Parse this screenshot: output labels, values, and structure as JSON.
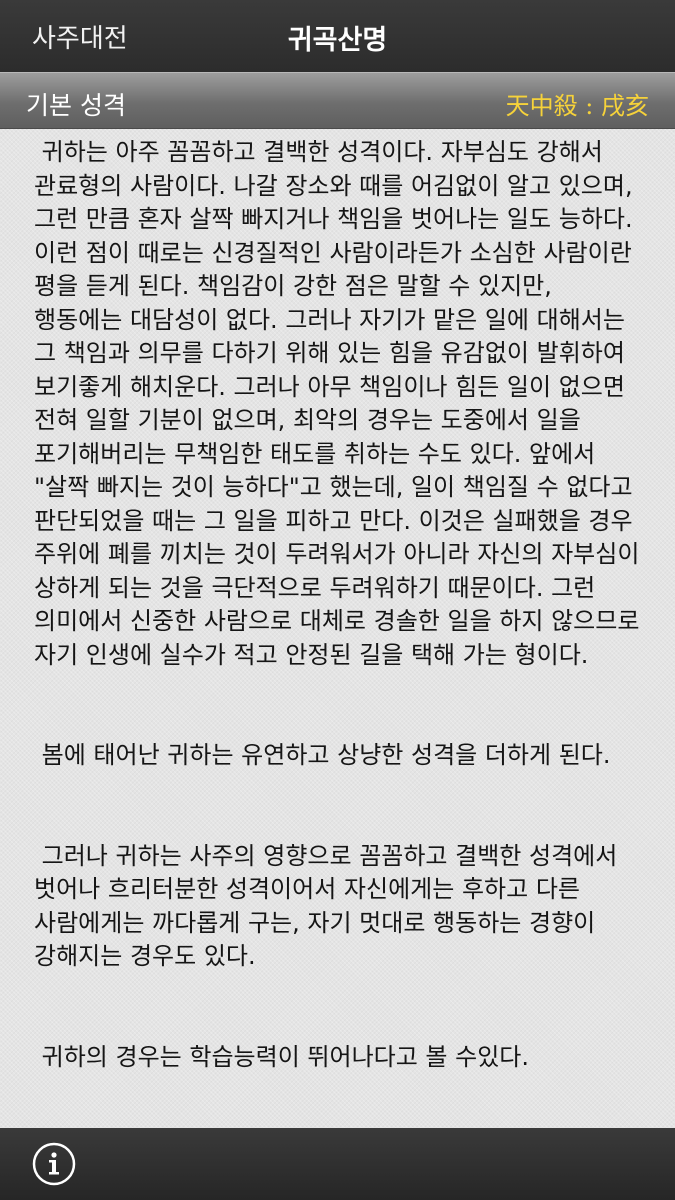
{
  "header": {
    "back_label": "사주대전",
    "title": "귀곡산명"
  },
  "section": {
    "title": "기본 성격",
    "badge": "天中殺 : 戌亥"
  },
  "content": {
    "paragraphs": [
      " 귀하는 아주 꼼꼼하고 결백한 성격이다. 자부심도 강해서 관료형의 사람이다. 나갈 장소와 때를 어김없이 알고 있으며, 그런 만큼 혼자 살짝 빠지거나 책임을 벗어나는 일도 능하다. 이런 점이 때로는 신경질적인 사람이라든가 소심한 사람이란 평을 듣게 된다. 책임감이 강한 점은 말할 수 있지만, 행동에는 대담성이 없다. 그러나 자기가 맡은 일에 대해서는 그 책임과 의무를 다하기 위해 있는 힘을 유감없이 발휘하여 보기좋게 해치운다. 그러나 아무 책임이나 힘든 일이 없으면 전혀 일할 기분이 없으며, 최악의 경우는 도중에서 일을 포기해버리는 무책임한 태도를 취하는 수도 있다. 앞에서 \"살짝 빠지는 것이 능하다\"고 했는데, 일이 책임질 수 없다고 판단되었을 때는 그 일을 피하고 만다. 이것은 실패했을 경우 주위에 폐를 끼치는 것이 두려워서가 아니라 자신의 자부심이 상하게 되는 것을 극단적으로 두려워하기 때문이다. 그런 의미에서 신중한 사람으로 대체로 경솔한 일을 하지 않으므로 자기 인생에 실수가 적고 안정된 길을 택해 가는 형이다.",
      " 봄에 태어난 귀하는 유연하고 상냥한 성격을 더하게 된다.",
      " 그러나 귀하는 사주의 영향으로 꼼꼼하고 결백한 성격에서 벗어나 흐리터분한 성격이어서 자신에게는 후하고 다른 사람에게는 까다롭게 구는, 자기 멋대로 행동하는 경향이 강해지는 경우도 있다.",
      " 귀하의 경우는 학습능력이 뛰어나다고 볼 수있다."
    ]
  },
  "footer": {
    "info_icon": "info-icon"
  }
}
